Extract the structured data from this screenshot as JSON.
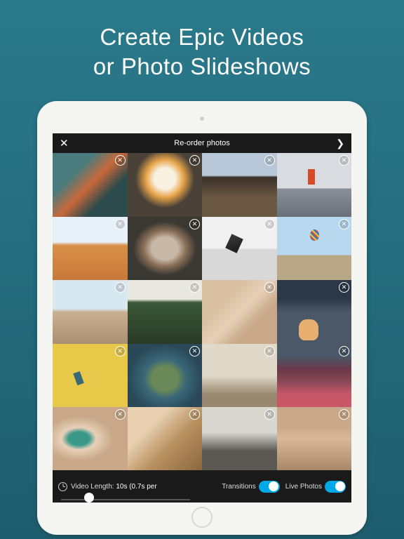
{
  "heading_line1": "Create Epic Videos",
  "heading_line2": "or Photo Slideshows",
  "topbar": {
    "title": "Re-order photos"
  },
  "grid": {
    "count": 20
  },
  "bottom": {
    "video_length_label": "Video Length:",
    "video_length_value": "10s (0.7s per",
    "transitions_label": "Transitions",
    "transitions_on": true,
    "live_photos_label": "Live Photos",
    "live_photos_on": true
  }
}
